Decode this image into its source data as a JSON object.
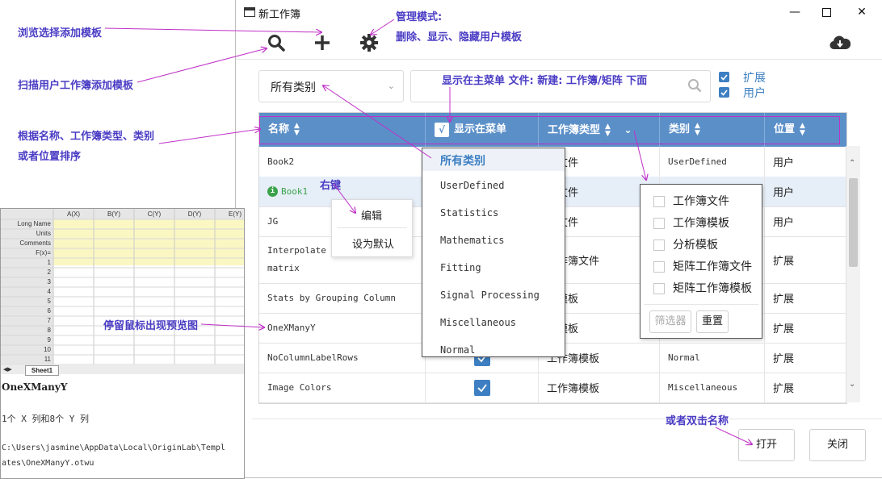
{
  "window": {
    "title": "新工作簿",
    "controls": [
      "minimize",
      "maximize",
      "close"
    ]
  },
  "toolbar": {
    "icons": [
      "search-icon",
      "plus-icon",
      "gear-icon",
      "cloud-download-icon"
    ]
  },
  "filter": {
    "category_dropdown": "所有类别",
    "search_placeholder": "",
    "checks": [
      {
        "label": "扩展",
        "checked": true
      },
      {
        "label": "用户",
        "checked": true
      }
    ]
  },
  "table": {
    "headers": [
      "名称",
      "显示在菜单",
      "工作簿类型",
      "类别",
      "位置"
    ],
    "rows": [
      {
        "name": "Book2",
        "type": "簿文件",
        "category": "UserDefined",
        "location": "用户",
        "info": false
      },
      {
        "name": "Book1",
        "type": "簿文件",
        "category": "",
        "location": "用户",
        "info": true
      },
      {
        "name": "JG",
        "type": "簿文件",
        "category": "",
        "location": "用户",
        "info": false
      },
      {
        "name": "Interpolate m",
        "name2": "matrix",
        "type": "工作簿文件",
        "category": "",
        "location": "扩展",
        "info": false
      },
      {
        "name": "Stats by Grouping Column",
        "type": "簿模板",
        "category": "",
        "location": "扩展",
        "info": false
      },
      {
        "name": "OneXManyY",
        "type": "簿模板",
        "category": "",
        "location": "扩展",
        "info": false
      },
      {
        "name": "NoColumnLabelRows",
        "type": "工作簿模板",
        "category": "Normal",
        "location": "扩展",
        "info": false,
        "checked": true
      },
      {
        "name": "Image Colors",
        "type": "工作簿模板",
        "category": "Miscellaneous",
        "location": "扩展",
        "info": false,
        "checked": true
      }
    ]
  },
  "category_popup": {
    "items": [
      "所有类别",
      "UserDefined",
      "Statistics",
      "Mathematics",
      "Fitting",
      "Signal Processing",
      "Miscellaneous",
      "Normal"
    ]
  },
  "type_filter_popup": {
    "items": [
      "工作簿文件",
      "工作簿模板",
      "分析模板",
      "矩阵工作簿文件",
      "矩阵工作簿模板"
    ],
    "filter_button": "筛选器",
    "reset_button": "重置"
  },
  "context_menu": {
    "items": [
      "编辑",
      "设为默认"
    ]
  },
  "footer": {
    "open_button": "打开",
    "close_button": "关闭"
  },
  "preview": {
    "columns": [
      "A(X)",
      "B(Y)",
      "C(Y)",
      "D(Y)",
      "E(Y)"
    ],
    "label_rows": [
      "Long Name",
      "Units",
      "Comments",
      "F(x)="
    ],
    "row_numbers": [
      "1",
      "2",
      "3",
      "4",
      "5",
      "6",
      "7",
      "8",
      "9",
      "10",
      "11"
    ],
    "sheet_tab": "Sheet1",
    "title": "OneXManyY",
    "description": "1个 X 列和8个 Y 列",
    "path_line1": "C:\\Users\\jasmine\\AppData\\Local\\OriginLab\\Templ",
    "path_line2": "ates\\OneXManyY.otwu"
  },
  "annotations": {
    "browse": "浏览选择添加模板",
    "manage_title": "管理模式:",
    "manage_desc": "删除、显示、隐藏用户模板",
    "scan": "扫描用户工作簿添加模板",
    "sort1": "根据名称、工作簿类型、类别",
    "sort2": "或者位置排序",
    "show_menu": "显示在主菜单 文件: 新建: 工作簿/矩阵 下面",
    "right_click": "右键",
    "hover": "停留鼠标出现预览图",
    "double_click": "或者双击名称"
  },
  "colors": {
    "header_blue": "#5b8fc8",
    "annotation": "#4a3cc4",
    "arrow": "#c030c8",
    "check_blue": "#3d7fc2"
  }
}
